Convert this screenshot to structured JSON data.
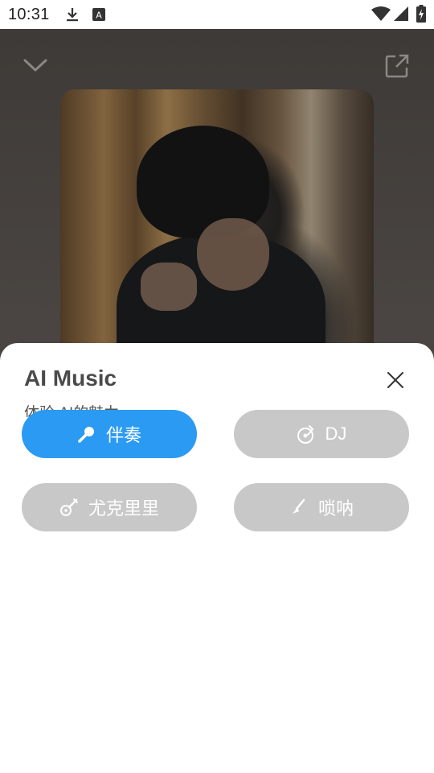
{
  "status_bar": {
    "time": "10:31",
    "icons": [
      "download-icon",
      "a-notification-icon",
      "wifi-icon",
      "signal-icon",
      "battery-icon"
    ]
  },
  "player": {
    "collapse_icon": "chevron-down-icon",
    "share_icon": "share-external-icon"
  },
  "sheet": {
    "title": "AI Music",
    "subtitle": "体验 AI的魅力",
    "close_icon": "close-icon",
    "options": [
      {
        "label": "伴奏",
        "icon": "microphone-icon",
        "state": "active"
      },
      {
        "label": "DJ",
        "icon": "turntable-icon",
        "state": "inactive"
      },
      {
        "label": "尤克里里",
        "icon": "guitar-icon",
        "state": "inactive"
      },
      {
        "label": "唢呐",
        "icon": "suona-icon",
        "state": "inactive"
      }
    ]
  },
  "colors": {
    "accent": "#2b9af3",
    "inactive_pill": "#c8c8c8",
    "sheet_bg": "#ffffff",
    "title_text": "#4a4a4a"
  }
}
